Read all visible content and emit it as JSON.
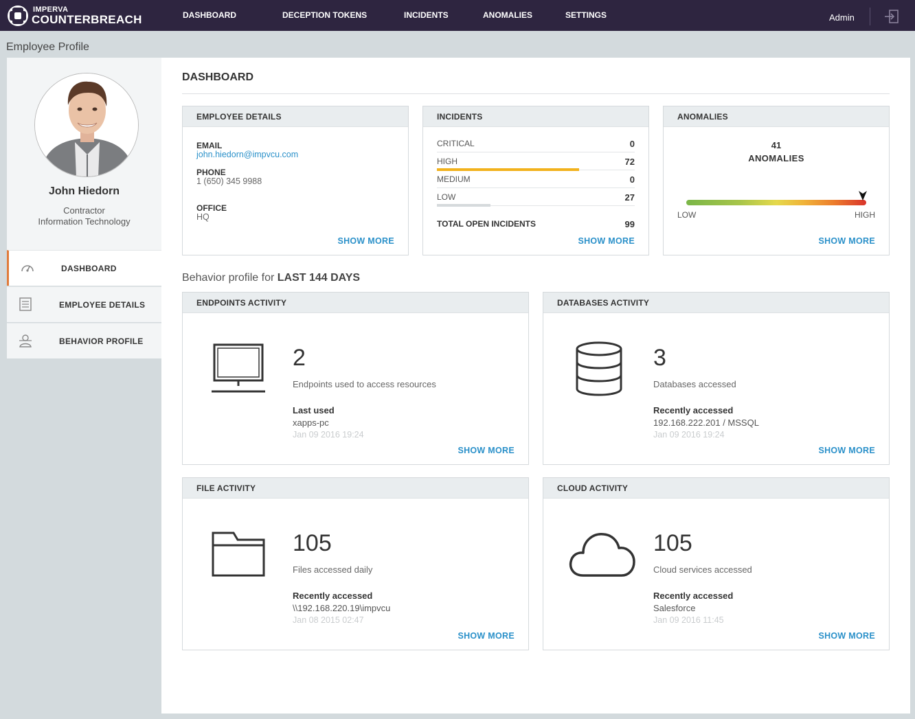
{
  "brand": {
    "small": "IMPERVA",
    "big": "COUNTERBREACH"
  },
  "nav": [
    {
      "label": "DASHBOARD"
    },
    {
      "label": "DECEPTION TOKENS"
    },
    {
      "label": "INCIDENTS"
    },
    {
      "label": "ANOMALIES"
    },
    {
      "label": "SETTINGS"
    }
  ],
  "user": {
    "name": "Admin",
    "logout_icon": "logout-icon"
  },
  "page_title": "Employee Profile",
  "employee": {
    "name": "John Hiedorn",
    "role": "Contractor",
    "department": "Information Technology"
  },
  "sidebar": [
    {
      "label": "DASHBOARD",
      "icon": "gauge-icon",
      "active": true
    },
    {
      "label": "EMPLOYEE DETAILS",
      "icon": "document-icon",
      "active": false
    },
    {
      "label": "BEHAVIOR PROFILE",
      "icon": "profile-icon",
      "active": false
    }
  ],
  "dashboard": {
    "title": "DASHBOARD",
    "show_more": "SHOW MORE",
    "employee_details": {
      "title": "EMPLOYEE DETAILS",
      "email_label": "EMAIL",
      "email": "john.hiedorn@impvcu.com",
      "phone_label": "PHONE",
      "phone": "1 (650) 345 9988",
      "office_label": "OFFICE",
      "office": "HQ"
    },
    "incidents": {
      "title": "INCIDENTS",
      "rows": [
        {
          "label": "CRITICAL",
          "count": "0",
          "fraction": 0,
          "color": "#e04a3b"
        },
        {
          "label": "HIGH",
          "count": "72",
          "fraction": 0.72,
          "color": "#f2b21c"
        },
        {
          "label": "MEDIUM",
          "count": "0",
          "fraction": 0,
          "color": "#e8c84a"
        },
        {
          "label": "LOW",
          "count": "27",
          "fraction": 0.27,
          "color": "#d6dadc"
        }
      ],
      "total_label": "TOTAL OPEN INCIDENTS",
      "total": "99"
    },
    "anomalies": {
      "title": "ANOMALIES",
      "count": "41",
      "label": "ANOMALIES",
      "low": "LOW",
      "high": "HIGH",
      "level": 0.98
    }
  },
  "behavior": {
    "prefix": "Behavior profile for",
    "period": "LAST 144 DAYS",
    "endpoints": {
      "title": "ENDPOINTS ACTIVITY",
      "icon": "laptop-icon",
      "count": "2",
      "desc": "Endpoints used to access resources",
      "label": "Last used",
      "value": "xapps-pc",
      "time": "Jan 09 2016 19:24"
    },
    "databases": {
      "title": "DATABASES ACTIVITY",
      "icon": "database-icon",
      "count": "3",
      "desc": "Databases accessed",
      "label": "Recently accessed",
      "value": "192.168.222.201 / MSSQL",
      "time": "Jan 09 2016 19:24"
    },
    "files": {
      "title": "FILE ACTIVITY",
      "icon": "folder-icon",
      "count": "105",
      "desc": "Files accessed daily",
      "label": "Recently accessed",
      "value": "\\\\192.168.220.19\\impvcu",
      "time": "Jan 08 2015 02:47"
    },
    "cloud": {
      "title": "CLOUD ACTIVITY",
      "icon": "cloud-icon",
      "count": "105",
      "desc": "Cloud services accessed",
      "label": "Recently accessed",
      "value": "Salesforce",
      "time": "Jan 09 2016 11:45"
    }
  }
}
